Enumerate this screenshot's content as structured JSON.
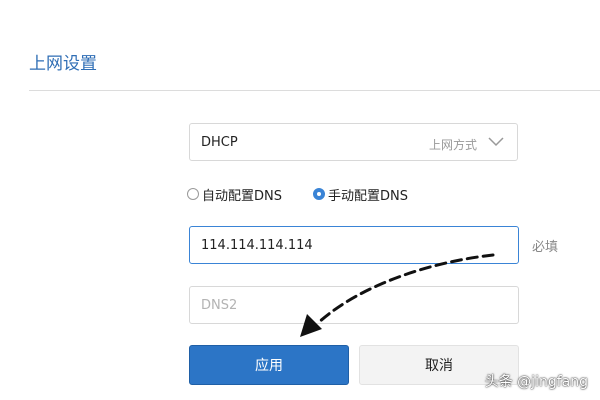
{
  "header": {
    "title": "上网设置"
  },
  "connection": {
    "value": "DHCP",
    "hint": "上网方式"
  },
  "dns_mode": {
    "options": [
      {
        "label": "自动配置DNS",
        "checked": false
      },
      {
        "label": "手动配置DNS",
        "checked": true
      }
    ]
  },
  "dns1": {
    "value": "114.114.114.114",
    "required_note": "必填"
  },
  "dns2": {
    "value": "",
    "placeholder": "DNS2"
  },
  "actions": {
    "apply_label": "应用",
    "cancel_label": "取消"
  },
  "watermark": "头条 @jingfang",
  "colors": {
    "accent": "#2c75c6",
    "title": "#2f6eb5",
    "active_border": "#3a84d6"
  }
}
